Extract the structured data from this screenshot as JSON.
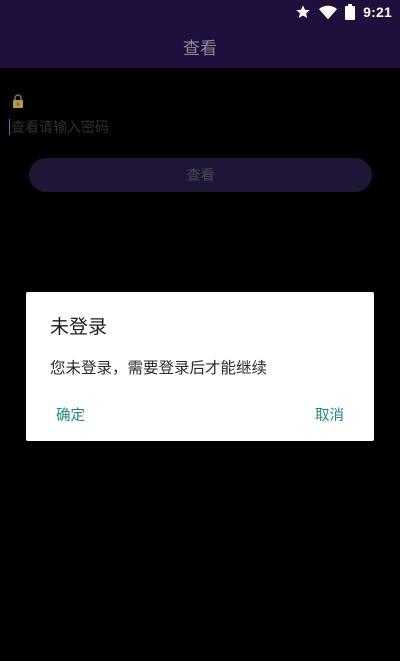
{
  "status_bar": {
    "time": "9:21",
    "icons": [
      "star-icon",
      "wifi-icon",
      "battery-icon"
    ]
  },
  "app_bar": {
    "title": "查看"
  },
  "form": {
    "lock_icon": "lock-icon",
    "password_placeholder": "查看请输入密码",
    "password_value": "",
    "view_button_label": "查看"
  },
  "dialog": {
    "title": "未登录",
    "message": "您未登录，需要登录后才能继续",
    "confirm_label": "确定",
    "cancel_label": "取消"
  },
  "colors": {
    "app_bar_bg": "#1e0f3d",
    "dialog_button_text": "#1f8a83",
    "view_button_bg": "#1f1537"
  }
}
